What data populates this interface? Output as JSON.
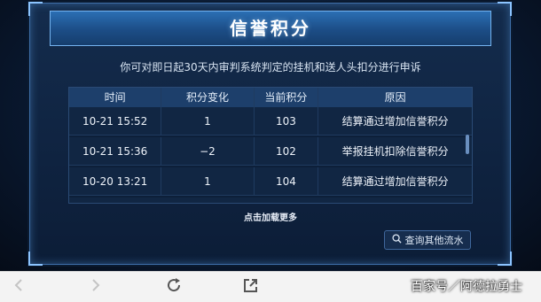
{
  "panel": {
    "title": "信誉积分",
    "notice": "你可对即日起30天内审判系统判定的挂机和送人头扣分进行申诉"
  },
  "table": {
    "headers": [
      "时间",
      "积分变化",
      "当前积分",
      "原因"
    ],
    "rows": [
      {
        "time": "10-21  15:52",
        "change": "1",
        "score": "103",
        "reason": "结算通过增加信誉积分"
      },
      {
        "time": "10-21  15:36",
        "change": "−2",
        "score": "102",
        "reason": "举报挂机扣除信誉积分"
      },
      {
        "time": "10-20  13:21",
        "change": "1",
        "score": "104",
        "reason": "结算通过增加信誉积分"
      }
    ]
  },
  "load_more": "点击加载更多",
  "search_button": {
    "label": "查询其他流水",
    "icon": "search-icon"
  },
  "browser_bar": {
    "icons": [
      "back-icon",
      "forward-icon",
      "refresh-icon",
      "share-icon"
    ]
  },
  "watermark": "百家号／阿德拉勇士"
}
